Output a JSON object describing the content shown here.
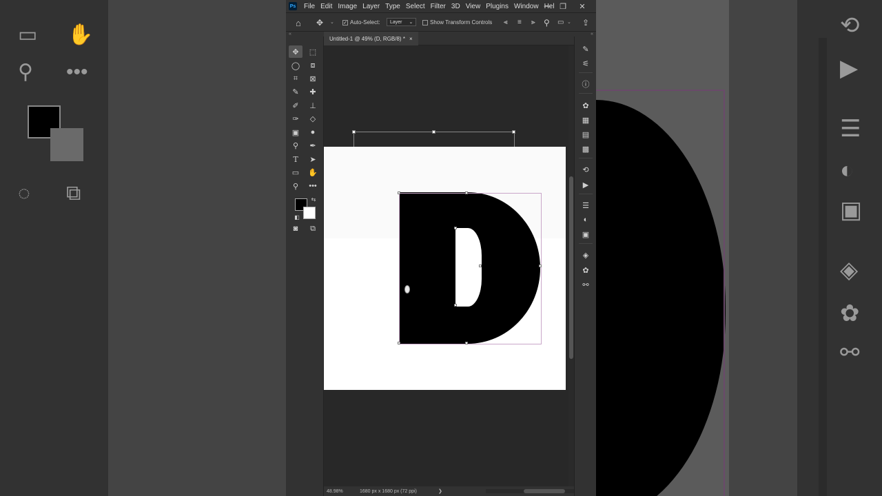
{
  "menubar": {
    "logo": "Ps",
    "items": [
      "File",
      "Edit",
      "Image",
      "Layer",
      "Type",
      "Select",
      "Filter",
      "3D",
      "View",
      "Plugins",
      "Window",
      "Hel"
    ],
    "minimize": "—",
    "restore": "❐",
    "close": "✕"
  },
  "options": {
    "auto_select_label": "Auto-Select:",
    "auto_select_checked": "✓",
    "target_value": "Layer",
    "show_transform_label": "Show Transform Controls"
  },
  "collapse_arrows": "«",
  "document": {
    "tab_title": "Untitled-1 @ 49% (D, RGB/8) *",
    "tab_close": "×"
  },
  "status": {
    "zoom": "48.98%",
    "doc_info": "1680 px x 1680 px (72 ppi)",
    "arrow": "❯"
  },
  "colors": {
    "foreground": "#000000",
    "background": "#ffffff",
    "ui_dark": "#323232",
    "canvas_bg": "#282828",
    "bbox_color": "#c9a6c9"
  }
}
